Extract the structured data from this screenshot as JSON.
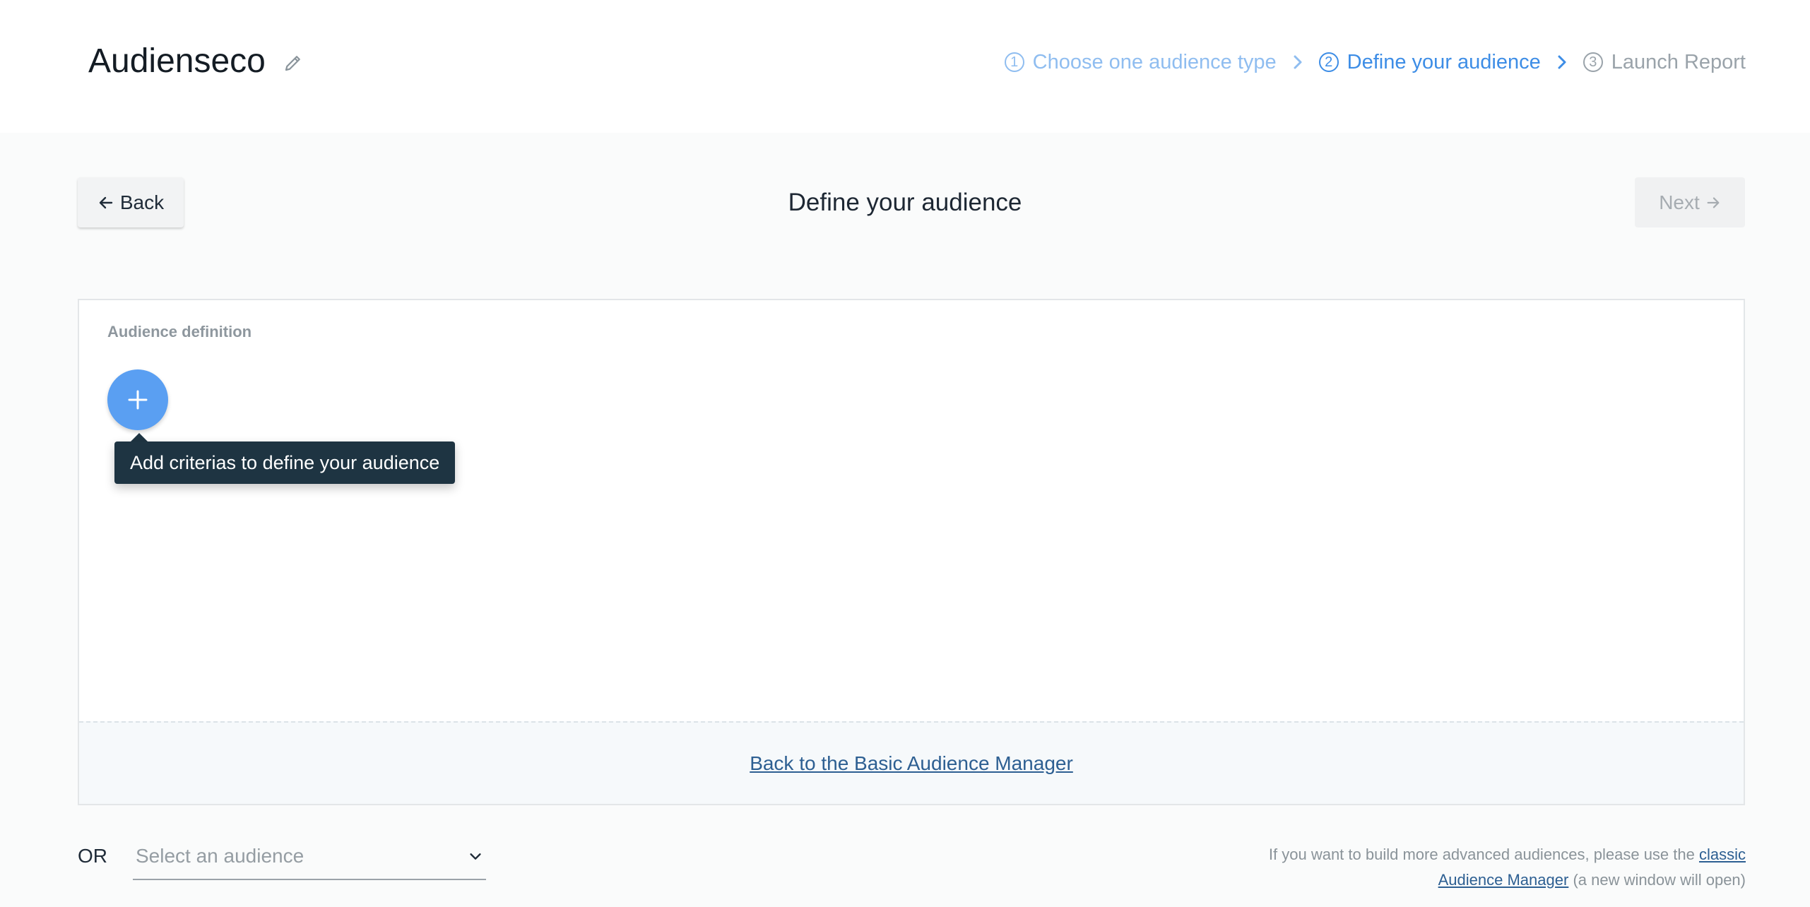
{
  "header": {
    "title": "Audienseco",
    "steps": [
      {
        "num": "1",
        "label": "Choose one audience type"
      },
      {
        "num": "2",
        "label": "Define your audience"
      },
      {
        "num": "3",
        "label": "Launch Report"
      }
    ]
  },
  "actions": {
    "back_label": "Back",
    "page_title": "Define your audience",
    "next_label": "Next"
  },
  "panel": {
    "label": "Audience definition",
    "tooltip": "Add criterias to define your audience",
    "basic_link": "Back to the Basic Audience Manager"
  },
  "footer": {
    "or_label": "OR",
    "select_placeholder": "Select an audience",
    "note_prefix": "If you want to build more advanced audiences, please use the",
    "classic_link": "classic Audience Manager",
    "note_suffix": "(a new window will open)"
  },
  "colors": {
    "accent": "#3d8de6",
    "add_button": "#5a9ff2",
    "tooltip_bg": "#1e3442",
    "link": "#2d5f92"
  },
  "icons": {
    "edit": "pencil-icon",
    "chevron": "chevron-right-icon",
    "back": "arrow-left-icon",
    "next": "arrow-right-icon",
    "add": "plus-icon",
    "dropdown": "chevron-down-icon"
  }
}
